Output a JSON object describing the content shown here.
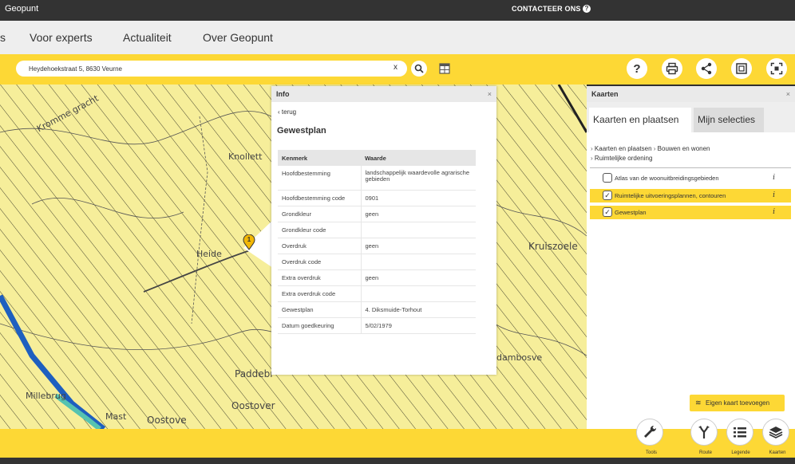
{
  "topbar": {
    "brand": "Geopunt",
    "contact": "CONTACTEER ONS",
    "help": "?"
  },
  "nav": {
    "items": [
      "s",
      "Voor experts",
      "Actualiteit",
      "Over Geopunt"
    ]
  },
  "search": {
    "value": "Heydehoekstraat 5, 8630 Veurne",
    "clear": "x"
  },
  "map": {
    "labels": [
      "Kromme gracht",
      "Knollett",
      "Heide",
      "Kruiszoele",
      "Paddebr",
      "Millebrug",
      "Mast",
      "Oostove",
      "Oostover",
      "dambosve"
    ],
    "marker": "1"
  },
  "info": {
    "header": "Info",
    "close": "×",
    "back": "terug",
    "title": "Gewestplan",
    "columns": [
      "Kenmerk",
      "Waarde"
    ],
    "rows": [
      [
        "Hoofdbestemming",
        "landschappelijk waardevolle agrarische gebieden"
      ],
      [
        "Hoofdbestemming code",
        "0901"
      ],
      [
        "Grondkleur",
        "geen"
      ],
      [
        "Grondkleur code",
        ""
      ],
      [
        "Overdruk",
        "geen"
      ],
      [
        "Overdruk code",
        ""
      ],
      [
        "Extra overdruk",
        "geen"
      ],
      [
        "Extra overdruk code",
        ""
      ],
      [
        "Gewestplan",
        "4. Diksmuide-Torhout"
      ],
      [
        "Datum goedkeuring",
        "5/02/1979"
      ]
    ]
  },
  "kaarten": {
    "header": "Kaarten",
    "close": "×",
    "tabs": [
      "Kaarten en plaatsen",
      "Mijn selecties"
    ],
    "breadcrumb": [
      "Kaarten en plaatsen",
      "Bouwen en wonen",
      "Ruimtelijke ordening"
    ],
    "layers": [
      {
        "label": "Atlas van de woonuitbreidingsgebieden",
        "checked": false
      },
      {
        "label": "Ruimtelijke uitvoeringsplannen, contouren",
        "checked": true
      },
      {
        "label": "Gewestplan",
        "checked": true
      }
    ],
    "info_glyph": "i",
    "add_map": "Eigen kaart toevoegen"
  },
  "bottom": {
    "buttons": [
      "Tools",
      "Route",
      "Legende",
      "Kaarten"
    ]
  },
  "colors": {
    "accent": "#fdd835",
    "dark": "#333333",
    "map": "#f6ee9a",
    "river": "#1e5fbf"
  }
}
